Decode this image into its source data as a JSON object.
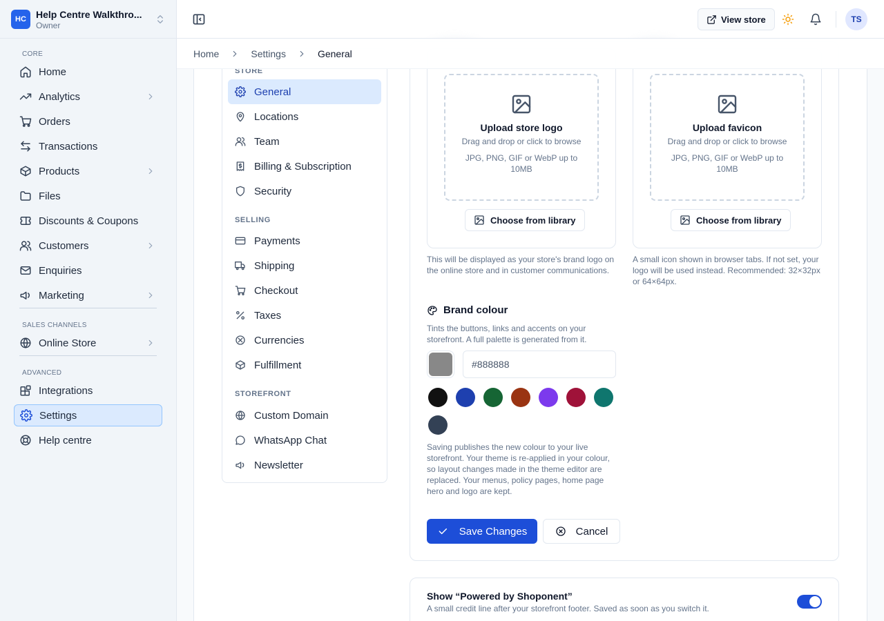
{
  "workspace": {
    "initials": "HC",
    "name": "Help Centre Walkthro...",
    "role": "Owner"
  },
  "sidebar": {
    "sections": [
      "CORE",
      "SALES CHANNELS",
      "ADVANCED"
    ],
    "items": [
      {
        "label": "Home"
      },
      {
        "label": "Analytics"
      },
      {
        "label": "Orders"
      },
      {
        "label": "Transactions"
      },
      {
        "label": "Products"
      },
      {
        "label": "Files"
      },
      {
        "label": "Discounts & Coupons"
      },
      {
        "label": "Customers"
      },
      {
        "label": "Enquiries"
      },
      {
        "label": "Marketing"
      },
      {
        "label": "Online Store"
      },
      {
        "label": "Integrations"
      },
      {
        "label": "Settings"
      },
      {
        "label": "Help centre"
      }
    ]
  },
  "header": {
    "view_store": "View store",
    "avatar": "TS"
  },
  "breadcrumb": [
    "Home",
    "Settings",
    "General"
  ],
  "settings_nav": {
    "sections": [
      "STORE",
      "SELLING",
      "STOREFRONT"
    ],
    "items": [
      {
        "label": "General"
      },
      {
        "label": "Locations"
      },
      {
        "label": "Team"
      },
      {
        "label": "Billing & Subscription"
      },
      {
        "label": "Security"
      },
      {
        "label": "Payments"
      },
      {
        "label": "Shipping"
      },
      {
        "label": "Checkout"
      },
      {
        "label": "Taxes"
      },
      {
        "label": "Currencies"
      },
      {
        "label": "Fulfillment"
      },
      {
        "label": "Custom Domain"
      },
      {
        "label": "WhatsApp Chat"
      },
      {
        "label": "Newsletter"
      }
    ]
  },
  "logo_upload": {
    "title": "Upload store logo",
    "sub": "Drag and drop or click to browse",
    "formats": "JPG, PNG, GIF or WebP up to 10MB",
    "library": "Choose from library",
    "help": "This will be displayed as your store's brand logo on the online store and in customer communications."
  },
  "favicon_upload": {
    "title": "Upload favicon",
    "sub": "Drag and drop or click to browse",
    "formats": "JPG, PNG, GIF or WebP up to 10MB",
    "library": "Choose from library",
    "help": "A small icon shown in browser tabs. If not set, your logo will be used instead. Recommended: 32×32px or 64×64px."
  },
  "brand_colour": {
    "title": "Brand colour",
    "description": "Tints the buttons, links and accents on your storefront. A full palette is generated from it.",
    "value": "#888888",
    "placeholder": "#888888",
    "current": "#888888",
    "presets": [
      "#111111",
      "#1e40af",
      "#166534",
      "#9a3412",
      "#7c3aed",
      "#9f1239",
      "#0f766e",
      "#334155"
    ],
    "note": "Saving publishes the new colour to your live storefront. Your theme is re-applied in your colour, so layout changes made in the theme editor are replaced. Your menus, policy pages, home page hero and logo are kept."
  },
  "actions": {
    "save": "Save Changes",
    "cancel": "Cancel"
  },
  "powered_by": {
    "title": "Show “Powered by Shoponent”",
    "sub": "A small credit line after your storefront footer. Saved as soon as you switch it.",
    "enabled": true
  },
  "colors": {
    "accent": "#1d4ed8",
    "active_bg": "#dbeafe"
  }
}
